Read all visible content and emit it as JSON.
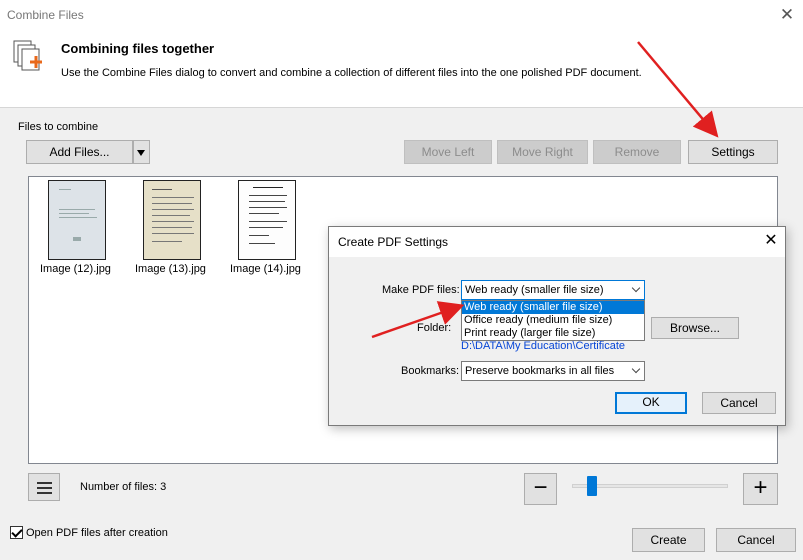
{
  "window": {
    "title": "Combine Files",
    "close_glyph": "✕"
  },
  "header": {
    "title": "Combining files together",
    "description": "Use the Combine Files dialog to convert and combine a collection of different files into the one polished PDF document.",
    "icon": "combine-files-icon"
  },
  "files_group": {
    "label": "Files to combine"
  },
  "toolbar": {
    "add_files": "Add Files...",
    "move_left": "Move Left",
    "move_right": "Move Right",
    "remove": "Remove",
    "settings": "Settings"
  },
  "files": [
    {
      "name": "Image (12).jpg"
    },
    {
      "name": "Image (13).jpg"
    },
    {
      "name": "Image (14).jpg"
    }
  ],
  "bottom": {
    "file_count": "Number of files: 3",
    "zoom_minus": "−",
    "zoom_plus": "+",
    "zoom_level": 0.15,
    "open_after_label": "Open PDF files after creation",
    "open_after_checked": true,
    "create": "Create",
    "cancel": "Cancel"
  },
  "modal": {
    "title": "Create PDF Settings",
    "close_glyph": "✕",
    "make_pdf_label": "Make PDF files:",
    "make_pdf_value": "Web ready (smaller file size)",
    "make_pdf_options": [
      "Web ready (smaller file size)",
      "Office ready (medium file size)",
      "Print ready (larger file size)"
    ],
    "folder_label": "Folder:",
    "browse": "Browse...",
    "folder_path": "D:\\DATA\\My Education\\Certificate",
    "bookmarks_label": "Bookmarks:",
    "bookmarks_value": "Preserve bookmarks in all files",
    "ok": "OK",
    "cancel": "Cancel"
  },
  "colors": {
    "accent": "#0078d7",
    "annotation_arrow": "#e02020",
    "link": "#0645d6"
  }
}
